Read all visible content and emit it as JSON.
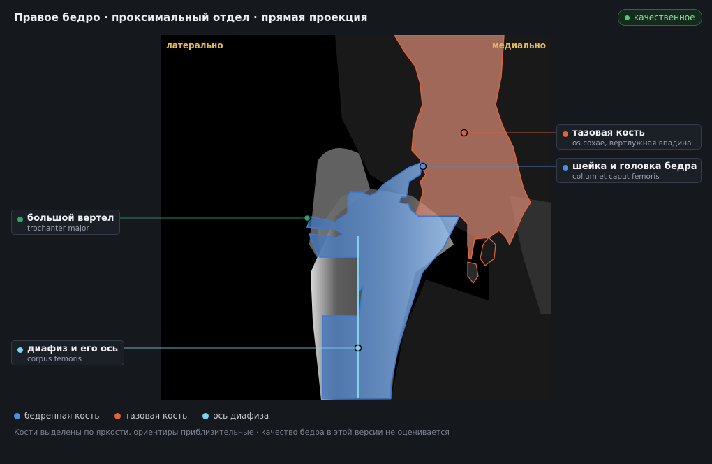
{
  "header": {
    "title": "Правое бедро · проксимальный отдел · прямая проекция"
  },
  "status_badge": {
    "label": "качественное",
    "color": "#4ccd6b"
  },
  "viewer": {
    "orientation_left": "латерально",
    "orientation_right": "медиально"
  },
  "callouts": [
    {
      "name": "тазовая кость",
      "latin": "os coxae, вертлужная впадина",
      "color": "#e0643a"
    },
    {
      "name": "шейка и головка бедра",
      "latin": "collum et caput femoris",
      "color": "#4a90e2"
    },
    {
      "name": "большой вертел",
      "latin": "trochanter major",
      "color": "#2aa66a"
    },
    {
      "name": "диафиз и его ось",
      "latin": "corpus femoris",
      "color": "#7fd3f0"
    }
  ],
  "legend": [
    {
      "label": "бедренная кость",
      "color": "#4a90e2"
    },
    {
      "label": "тазовая кость",
      "color": "#e0643a"
    },
    {
      "label": "ось диафиза",
      "color": "#7fd3f0"
    }
  ],
  "footnote": "Кости выделены по яркости, ориентиры приблизительные · качество бедра в этой версии не оценивается"
}
